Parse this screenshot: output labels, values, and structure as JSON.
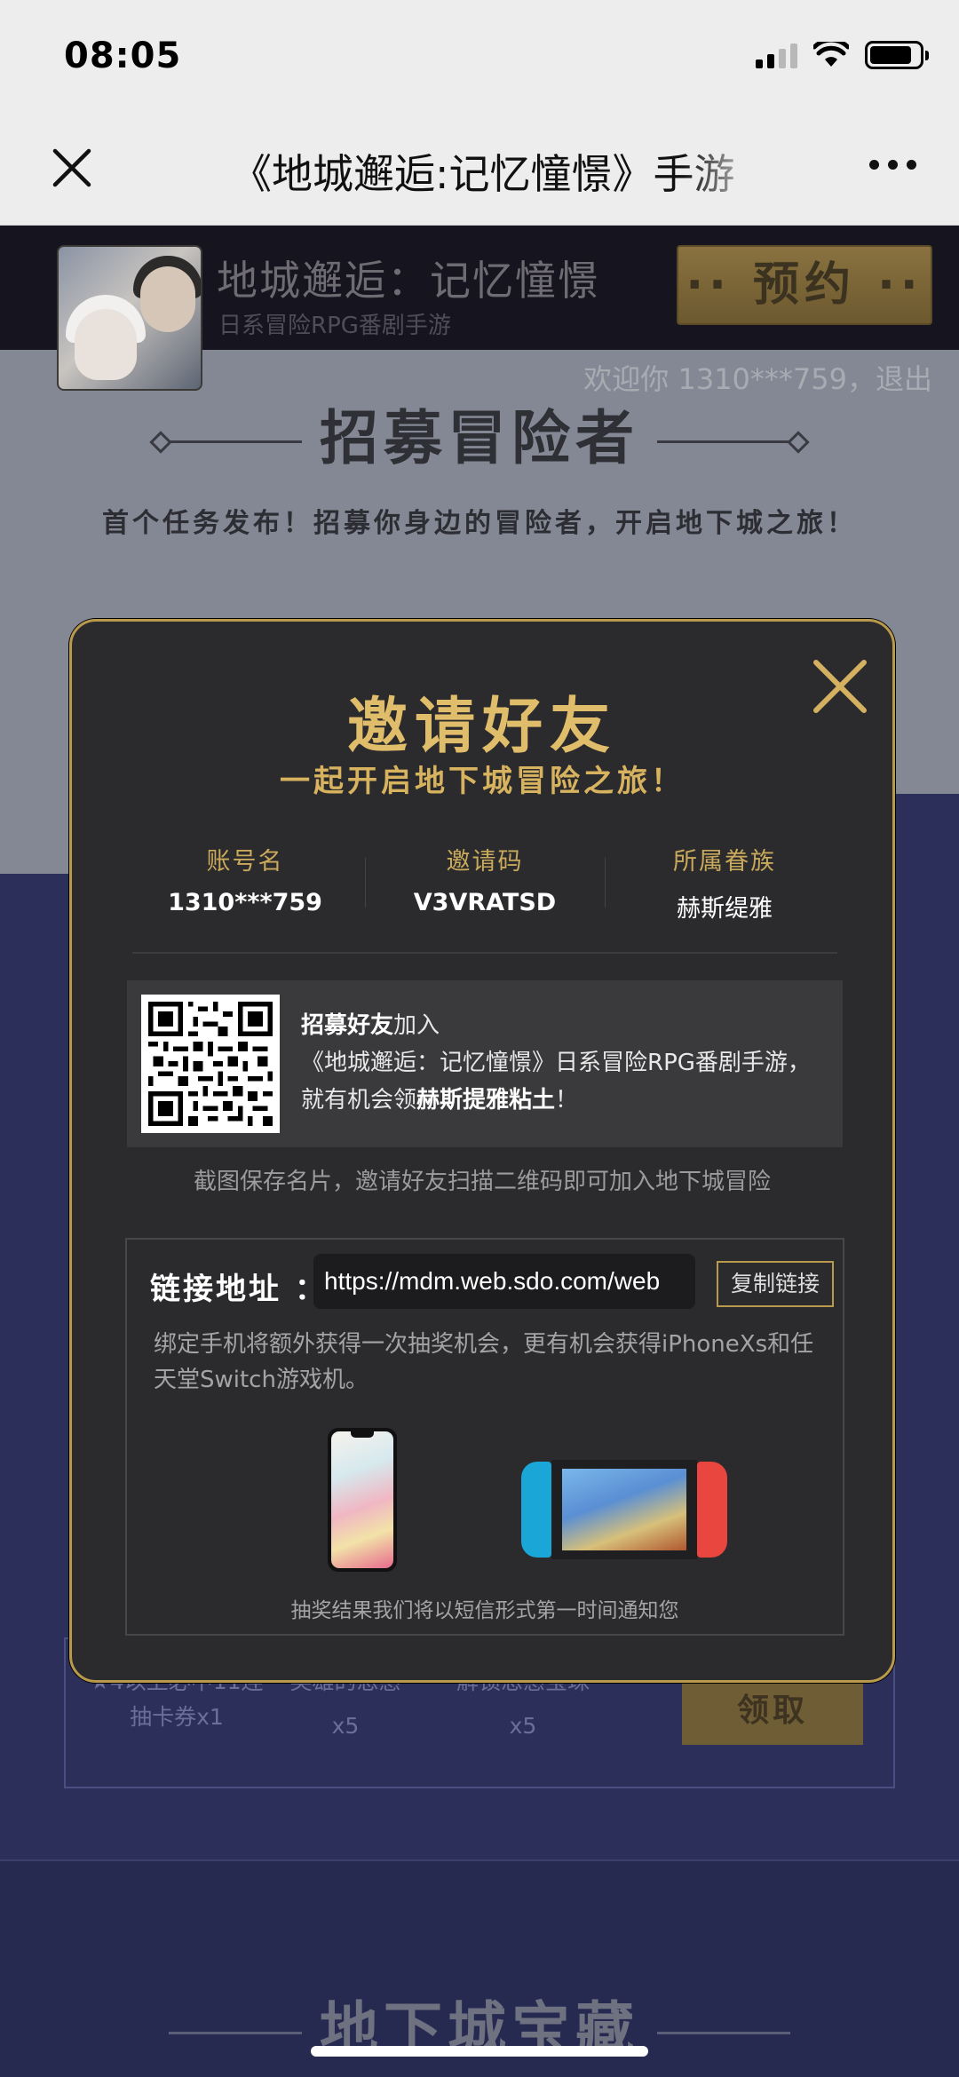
{
  "status_bar": {
    "time": "08:05"
  },
  "nav": {
    "title": "《地城邂逅:记忆憧憬》手游"
  },
  "banner": {
    "game_name": "地城邂逅：记忆憧憬",
    "game_sub": "日系冒险RPG番剧手游",
    "reserve_label": "·· 预约 ··",
    "welcome": "欢迎你  1310***759，退出"
  },
  "recruit": {
    "title": "招募冒险者",
    "desc": "首个任务发布！招募你身边的冒险者，开启地下城之旅！"
  },
  "rewards": {
    "items": [
      {
        "name": "★4以上必中11连抽卡券x1"
      },
      {
        "name": "英雄的恩惠",
        "count": "x5"
      },
      {
        "name": "解锁恩惠宝珠",
        "count": "x5"
      }
    ],
    "claim_label": "领取"
  },
  "treasure": {
    "title": "地下城宝藏"
  },
  "modal": {
    "title": "邀请好友",
    "subtitle": "一起开启地下城冒险之旅！",
    "info": {
      "account_label": "账号名",
      "account_value": "1310***759",
      "code_label": "邀请码",
      "code_value": "V3VRATSD",
      "family_label": "所属眷族",
      "family_value": "赫斯缇雅"
    },
    "qr_text": {
      "bold1": "招募好友",
      "text1": "加入",
      "line2": "《地城邂逅：记忆憧憬》日系冒险RPG番剧手游，",
      "text3": "就有机会领",
      "bold3": "赫斯提雅粘土",
      "end3": "！"
    },
    "save_hint": "截图保存名片，邀请好友扫描二维码即可加入地下城冒险",
    "link": {
      "label": "链接地址 ：",
      "url": "https://mdm.web.sdo.com/web",
      "copy_label": "复制链接",
      "desc": "绑定手机将额外获得一次抽奖机会，更有机会获得iPhoneXs和任天堂Switch游戏机。",
      "draw_note": "抽奖结果我们将以短信形式第一时间通知您"
    }
  },
  "colors": {
    "gold": "#e0bd6a",
    "modal_bg": "#2b2a2c",
    "page_blue": "#2b2f5a"
  },
  "icons": [
    "close-icon",
    "more-icon",
    "modal-close-icon",
    "signal-icon",
    "wifi-icon",
    "battery-icon",
    "qr-code-icon"
  ]
}
